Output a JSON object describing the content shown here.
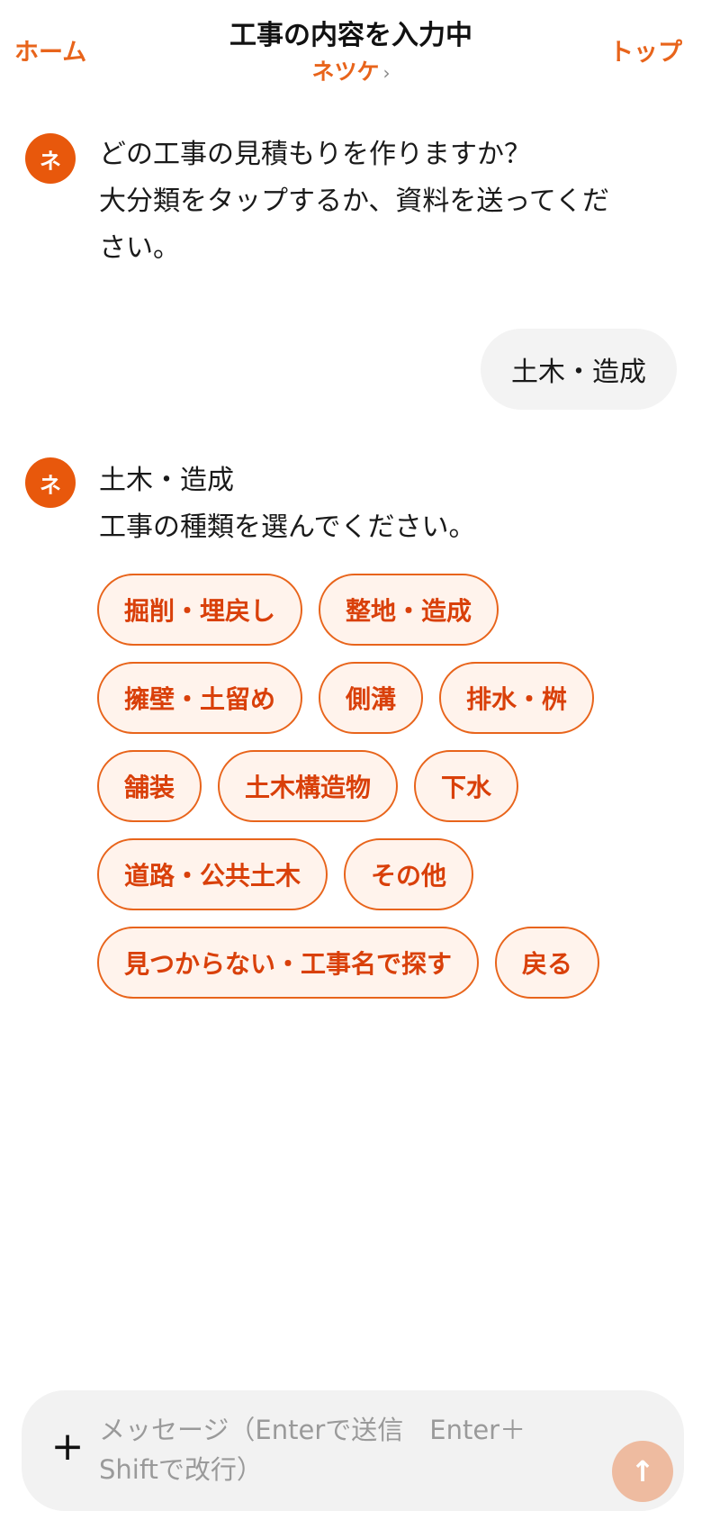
{
  "header": {
    "home_label": "ホーム",
    "title": "工事の内容を入力中",
    "subtitle": "ネツケ",
    "subtitle_chevron": "›",
    "top_label": "トップ"
  },
  "messages": {
    "bot1": {
      "avatar": "ネ",
      "lines": [
        "どの工事の見積もりを作りますか？",
        "大分類をタップするか、資料を送ってくだ",
        "さい。"
      ]
    },
    "user1": {
      "text": "土木・造成"
    },
    "bot2": {
      "avatar": "ネ",
      "lines": [
        "土木・造成",
        "工事の種類を選んでください。"
      ]
    }
  },
  "choices": [
    "掘削・埋戻し",
    "整地・造成",
    "擁壁・土留め",
    "側溝",
    "排水・桝",
    "舗装",
    "土木構造物",
    "下水",
    "道路・公共土木",
    "その他",
    "見つからない・工事名で探す",
    "戻る"
  ],
  "composer": {
    "placeholder": "メッセージ（Enterで送信　Enter＋Shiftで改行）",
    "value": "",
    "plus_icon": "+",
    "send_icon": "↑"
  },
  "colors": {
    "accent": "#e8641b",
    "chip_text": "#d9400a",
    "chip_bg": "#fff3ec",
    "avatar_bg": "#e8580c",
    "send_button": "#eebba0",
    "bubble_bg": "#f3f3f3"
  }
}
